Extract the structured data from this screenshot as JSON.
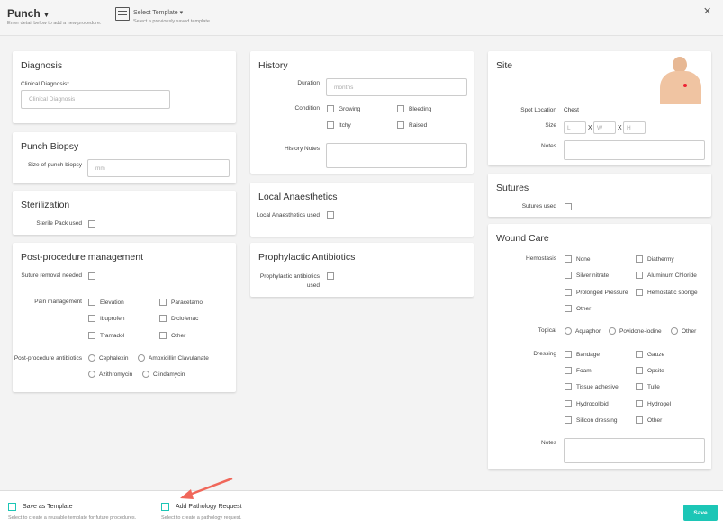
{
  "header": {
    "title": "Punch",
    "subtitle": "Enter detail below to add a new procedure.",
    "template_label": "Select Template",
    "template_sub": "Select a previously saved template"
  },
  "diagnosis": {
    "title": "Diagnosis",
    "label": "Clinical Diagnosis*",
    "placeholder": "Clinical Diagnosis"
  },
  "biopsy": {
    "title": "Punch Biopsy",
    "label": "Size of punch biopsy",
    "placeholder": "mm"
  },
  "sterilization": {
    "title": "Sterilization",
    "label": "Sterile Pack used"
  },
  "post": {
    "title": "Post-procedure management",
    "suture_label": "Suture removal needed",
    "pain_label": "Pain management",
    "pain": [
      "Elevation",
      "Paracetamol",
      "Ibuprofen",
      "Diclofenac",
      "Tramadol",
      "Other"
    ],
    "abx_label": "Post-procedure antibiotics",
    "abx": [
      "Cephalexin",
      "Amoxicillin Clavulanate",
      "Azithromycin",
      "Clindamycin"
    ]
  },
  "history": {
    "title": "History",
    "duration_label": "Duration",
    "duration_placeholder": "months",
    "condition_label": "Condition",
    "conditions": [
      "Growing",
      "Bleeding",
      "Itchy",
      "Raised"
    ],
    "notes_label": "History Notes"
  },
  "local": {
    "title": "Local Anaesthetics",
    "label": "Local Anaesthetics used"
  },
  "prophylactic": {
    "title": "Prophylactic Antibiotics",
    "label": "Prophylactic antibiotics used"
  },
  "site": {
    "title": "Site",
    "spot_label": "Spot Location",
    "spot_value": "Chest",
    "size_label": "Size",
    "size_l": "L",
    "size_w": "W",
    "size_h": "H",
    "x": "X",
    "notes_label": "Notes"
  },
  "sutures": {
    "title": "Sutures",
    "label": "Sutures used"
  },
  "wound": {
    "title": "Wound Care",
    "hemo_label": "Hemostasis",
    "hemo": [
      "None",
      "Diathermy",
      "Silver nitrate",
      "Aluminum Chloride",
      "Prolonged Pressure",
      "Hemostatic sponge",
      "Other"
    ],
    "topical_label": "Topical",
    "topical": [
      "Aquaphor",
      "Povidone-iodine",
      "Other"
    ],
    "dressing_label": "Dressing",
    "dressing": [
      "Bandage",
      "Gauze",
      "Foam",
      "Opsite",
      "Tissue adhesive",
      "Tulle",
      "Hydrocolloid",
      "Hydrogel",
      "Silicon dressing",
      "Other"
    ],
    "notes_label": "Notes"
  },
  "footer": {
    "save_template": "Save as Template",
    "save_template_sub": "Select to create a reusable template for future procedures.",
    "pathology": "Add Pathology Request",
    "pathology_sub": "Select to create a pathology request.",
    "save": "Save"
  },
  "colors": {
    "accent": "#1cc6b6",
    "arrow": "#f0675a"
  }
}
